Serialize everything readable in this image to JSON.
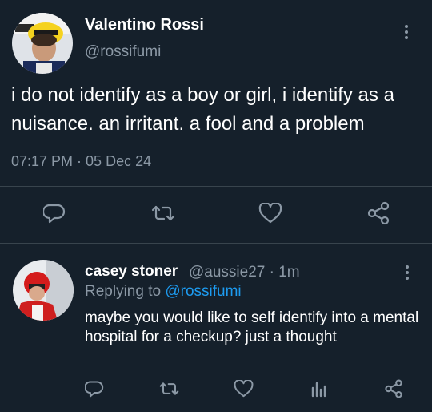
{
  "main_tweet": {
    "author_name": "Valentino Rossi",
    "author_handle": "@rossifumi",
    "text": "i do not identify as a boy or girl, i identify as a nuisance. an irritant. a fool and a problem",
    "time": "07:17 PM",
    "separator": " · ",
    "date": "05 Dec 24",
    "icons": [
      "reply-icon",
      "retweet-icon",
      "like-icon",
      "share-icon"
    ]
  },
  "reply_tweet": {
    "author_name": "casey stoner",
    "author_handle": "@aussie27",
    "age": "· 1m",
    "replying_prefix": "Replying to",
    "replying_handle": "@rossifumi",
    "text": "maybe you would like to self identify into a mental hospital for a checkup? just a thought",
    "icons": [
      "reply-icon",
      "retweet-icon",
      "like-icon",
      "analytics-icon",
      "share-icon"
    ]
  },
  "colors": {
    "background": "#15202b",
    "secondary_text": "#8b98a5",
    "link": "#1d9bf0",
    "divider": "#38444d"
  }
}
